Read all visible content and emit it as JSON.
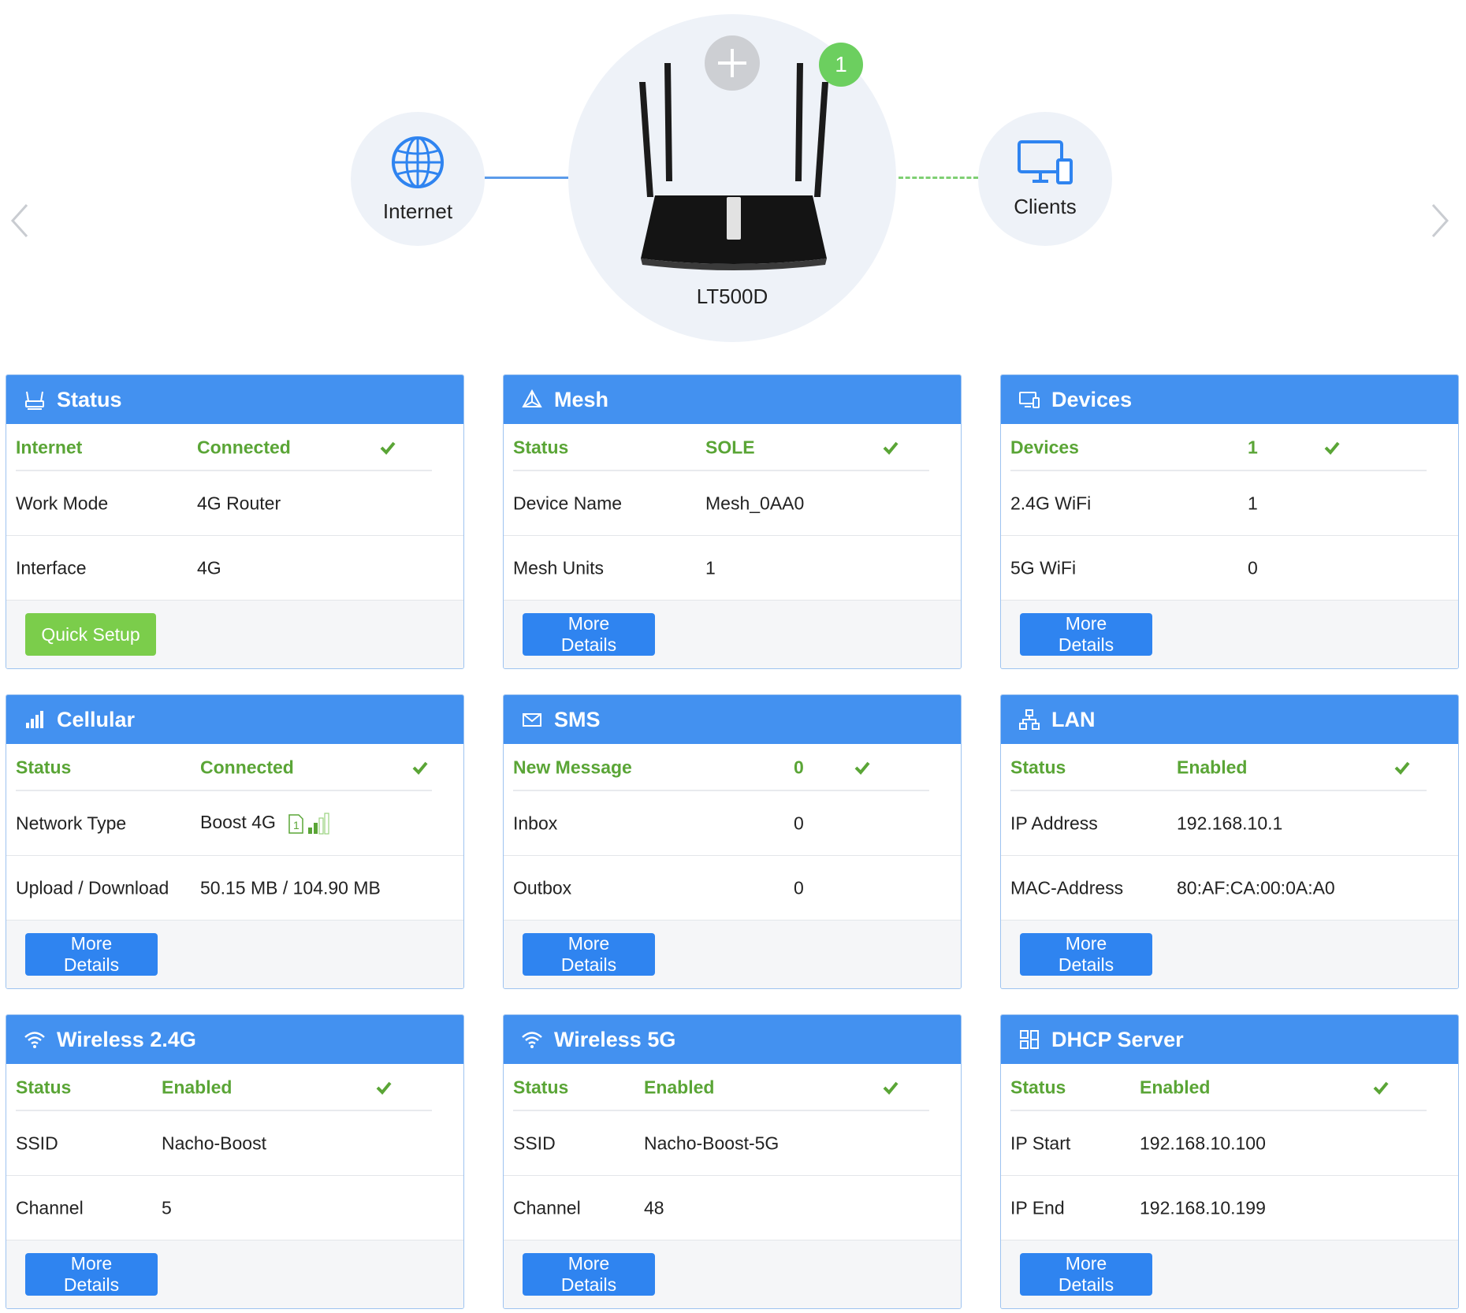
{
  "topology": {
    "internet_label": "Internet",
    "clients_label": "Clients",
    "router_name": "LT500D",
    "mesh_badge_count": "1",
    "colors": {
      "link": "#5b9bea",
      "dashed_link": "#7fcf73",
      "badge": "#6ccf5f",
      "bubble": "#eef2f8"
    }
  },
  "colors": {
    "header": "#4391f0",
    "ok_green": "#5aa536",
    "button_blue": "#2f84f0",
    "button_green": "#7bcd4b"
  },
  "cards": {
    "status": {
      "title": "Status",
      "icon": "router-icon",
      "summary": {
        "key": "Internet",
        "value": "Connected"
      },
      "rows": [
        {
          "key": "Work Mode",
          "value": "4G Router"
        },
        {
          "key": "Interface",
          "value": "4G"
        }
      ],
      "button": "Quick Setup"
    },
    "mesh": {
      "title": "Mesh",
      "icon": "mesh-icon",
      "summary": {
        "key": "Status",
        "value": "SOLE"
      },
      "rows": [
        {
          "key": "Device Name",
          "value": "Mesh_0AA0"
        },
        {
          "key": "Mesh Units",
          "value": "1"
        }
      ],
      "button": "More Details"
    },
    "devices": {
      "title": "Devices",
      "icon": "devices-icon",
      "summary": {
        "key": "Devices",
        "value": "1"
      },
      "rows": [
        {
          "key": "2.4G WiFi",
          "value": "1"
        },
        {
          "key": "5G WiFi",
          "value": "0"
        }
      ],
      "button": "More Details"
    },
    "cellular": {
      "title": "Cellular",
      "icon": "signal-bars-icon",
      "summary": {
        "key": "Status",
        "value": "Connected"
      },
      "rows": [
        {
          "key": "Network Type",
          "value": "Boost 4G"
        },
        {
          "key": "Upload / Download",
          "value": "50.15 MB / 104.90 MB"
        }
      ],
      "sim_slot": "1",
      "button": "More Details"
    },
    "sms": {
      "title": "SMS",
      "icon": "envelope-icon",
      "summary": {
        "key": "New Message",
        "value": "0"
      },
      "rows": [
        {
          "key": "Inbox",
          "value": "0"
        },
        {
          "key": "Outbox",
          "value": "0"
        }
      ],
      "button": "More Details"
    },
    "lan": {
      "title": "LAN",
      "icon": "lan-network-icon",
      "summary": {
        "key": "Status",
        "value": "Enabled"
      },
      "rows": [
        {
          "key": "IP Address",
          "value": "192.168.10.1"
        },
        {
          "key": "MAC-Address",
          "value": "80:AF:CA:00:0A:A0"
        }
      ],
      "button": "More Details"
    },
    "wifi24": {
      "title": "Wireless 2.4G",
      "icon": "wifi-icon",
      "summary": {
        "key": "Status",
        "value": "Enabled"
      },
      "rows": [
        {
          "key": "SSID",
          "value": "Nacho-Boost"
        },
        {
          "key": "Channel",
          "value": "5"
        }
      ],
      "button": "More Details"
    },
    "wifi5": {
      "title": "Wireless 5G",
      "icon": "wifi-icon",
      "summary": {
        "key": "Status",
        "value": "Enabled"
      },
      "rows": [
        {
          "key": "SSID",
          "value": "Nacho-Boost-5G"
        },
        {
          "key": "Channel",
          "value": "48"
        }
      ],
      "button": "More Details"
    },
    "dhcp": {
      "title": "DHCP Server",
      "icon": "dhcp-server-icon",
      "summary": {
        "key": "Status",
        "value": "Enabled"
      },
      "rows": [
        {
          "key": "IP Start",
          "value": "192.168.10.100"
        },
        {
          "key": "IP End",
          "value": "192.168.10.199"
        }
      ],
      "button": "More Details"
    }
  }
}
